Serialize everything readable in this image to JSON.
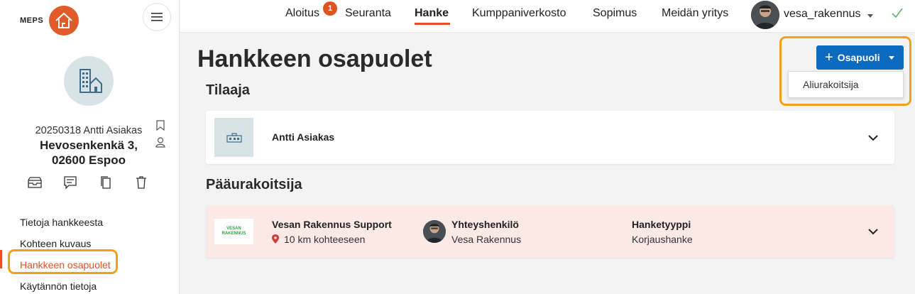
{
  "brand": {
    "name": "MEPS"
  },
  "sidebar": {
    "project_id": "20250318 Antti Asiakas",
    "address_line1": "Hevosenkenkä 3,",
    "address_line2": "02600 Espoo",
    "nav": [
      {
        "label": "Tietoja hankkeesta"
      },
      {
        "label": "Kohteen kuvaus"
      },
      {
        "label": "Hankkeen osapuolet"
      },
      {
        "label": "Käytännön tietoja"
      }
    ]
  },
  "topnav": {
    "tabs": [
      {
        "label": "Aloitus"
      },
      {
        "label": "Seuranta"
      },
      {
        "label": "Hanke"
      },
      {
        "label": "Kumppaniverkosto"
      },
      {
        "label": "Sopimus"
      },
      {
        "label": "Meidän yritys"
      }
    ],
    "notification_count": "1",
    "active_tab": "Hanke",
    "user_name": "vesa_rakennus"
  },
  "main": {
    "title": "Hankkeen osapuolet",
    "add_button": "Osapuoli",
    "dropdown_item": "Aliurakoitsija",
    "client_section": "Tilaaja",
    "client_name": "Antti Asiakas",
    "contractor_section": "Pääurakoitsija",
    "contractor": {
      "logo_text_1": "VESAN",
      "logo_text_2": "RAKENNUS",
      "name": "Vesan Rakennus Support",
      "distance": "10 km kohteeseen",
      "contact_label": "Yhteyshenkilö",
      "contact_name": "Vesa Rakennus",
      "type_label": "Hanketyyppi",
      "type_value": "Korjaushanke"
    }
  },
  "colors": {
    "accent": "#e0531f",
    "primary": "#0c6bbf",
    "highlight": "#f3a114",
    "contractor_bg": "#fbe9e5"
  }
}
